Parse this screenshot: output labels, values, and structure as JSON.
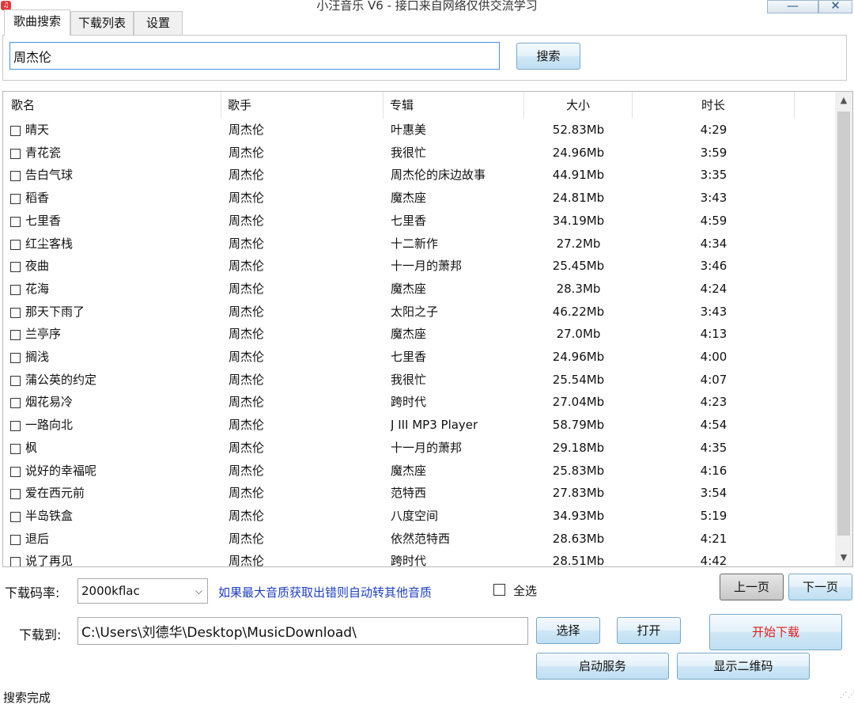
{
  "window": {
    "title": "小汪音乐 V6 - 接口来自网络仅供交流学习",
    "icon_glyph": "♫",
    "minimize_glyph": "—",
    "close_glyph": "✕"
  },
  "tabs": [
    {
      "label": "歌曲搜索",
      "active": true
    },
    {
      "label": "下载列表",
      "active": false
    },
    {
      "label": "设置",
      "active": false
    }
  ],
  "search": {
    "query": "周杰伦",
    "button_label": "搜索"
  },
  "list": {
    "columns": [
      "歌名",
      "歌手",
      "专辑",
      "大小",
      "时长"
    ],
    "rows": [
      {
        "title": "晴天",
        "artist": "周杰伦",
        "album": "叶惠美",
        "size": "52.83Mb",
        "duration": "4:29"
      },
      {
        "title": "青花瓷",
        "artist": "周杰伦",
        "album": "我很忙",
        "size": "24.96Mb",
        "duration": "3:59"
      },
      {
        "title": "告白气球",
        "artist": "周杰伦",
        "album": "周杰伦的床边故事",
        "size": "44.91Mb",
        "duration": "3:35"
      },
      {
        "title": "稻香",
        "artist": "周杰伦",
        "album": "魔杰座",
        "size": "24.81Mb",
        "duration": "3:43"
      },
      {
        "title": "七里香",
        "artist": "周杰伦",
        "album": "七里香",
        "size": "34.19Mb",
        "duration": "4:59"
      },
      {
        "title": "红尘客栈",
        "artist": "周杰伦",
        "album": "十二新作",
        "size": "27.2Mb",
        "duration": "4:34"
      },
      {
        "title": "夜曲",
        "artist": "周杰伦",
        "album": "十一月的萧邦",
        "size": "25.45Mb",
        "duration": "3:46"
      },
      {
        "title": "花海",
        "artist": "周杰伦",
        "album": "魔杰座",
        "size": "28.3Mb",
        "duration": "4:24"
      },
      {
        "title": "那天下雨了",
        "artist": "周杰伦",
        "album": "太阳之子",
        "size": "46.22Mb",
        "duration": "3:43"
      },
      {
        "title": "兰亭序",
        "artist": "周杰伦",
        "album": "魔杰座",
        "size": "27.0Mb",
        "duration": "4:13"
      },
      {
        "title": "搁浅",
        "artist": "周杰伦",
        "album": "七里香",
        "size": "24.96Mb",
        "duration": "4:00"
      },
      {
        "title": "蒲公英的约定",
        "artist": "周杰伦",
        "album": "我很忙",
        "size": "25.54Mb",
        "duration": "4:07"
      },
      {
        "title": "烟花易冷",
        "artist": "周杰伦",
        "album": "跨时代",
        "size": "27.04Mb",
        "duration": "4:23"
      },
      {
        "title": "一路向北",
        "artist": "周杰伦",
        "album": "J III MP3 Player",
        "size": "58.79Mb",
        "duration": "4:54"
      },
      {
        "title": "枫",
        "artist": "周杰伦",
        "album": "十一月的萧邦",
        "size": "29.18Mb",
        "duration": "4:35"
      },
      {
        "title": "说好的幸福呢",
        "artist": "周杰伦",
        "album": "魔杰座",
        "size": "25.83Mb",
        "duration": "4:16"
      },
      {
        "title": "爱在西元前",
        "artist": "周杰伦",
        "album": "范特西",
        "size": "27.83Mb",
        "duration": "3:54"
      },
      {
        "title": "半岛铁盒",
        "artist": "周杰伦",
        "album": "八度空间",
        "size": "34.93Mb",
        "duration": "5:19"
      },
      {
        "title": "退后",
        "artist": "周杰伦",
        "album": "依然范特西",
        "size": "28.63Mb",
        "duration": "4:21"
      },
      {
        "title": "说了再见",
        "artist": "周杰伦",
        "album": "跨时代",
        "size": "28.51Mb",
        "duration": "4:42"
      }
    ]
  },
  "scrollbar": {
    "up_glyph": "▲",
    "down_glyph": "▼"
  },
  "download": {
    "bitrate_label": "下载码率:",
    "bitrate_value": "2000kflac",
    "select_arrow": "⌵",
    "quality_hint": "如果最大音质获取出错则自动转其他音质",
    "select_all_label": "全选",
    "prev_page": "上一页",
    "next_page": "下一页",
    "save_to_label": "下载到:",
    "save_path": "C:\\Users\\刘德华\\Desktop\\MusicDownload\\",
    "choose_button": "选择",
    "open_button": "打开",
    "start_download_button": "开始下载",
    "start_service_button": "启动服务",
    "show_qr_button": "显示二维码"
  },
  "status": {
    "text": "搜索完成"
  },
  "colors": {
    "accent_blue": "#4a90d9",
    "hint_text": "#1c3fc4",
    "start_download_text": "#e11b1b"
  }
}
